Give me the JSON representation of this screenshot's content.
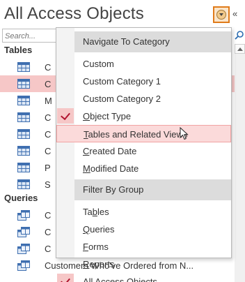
{
  "pane": {
    "title": "All Access Objects",
    "collapse_glyph": "«",
    "search_placeholder": "Search...",
    "groups": [
      {
        "name": "Tables",
        "icon": "table-icon",
        "items": [
          {
            "label": "C"
          },
          {
            "label": "C",
            "selected": true
          },
          {
            "label": "M"
          },
          {
            "label": "C"
          },
          {
            "label": "C"
          },
          {
            "label": "C"
          },
          {
            "label": "P"
          },
          {
            "label": "S"
          }
        ]
      },
      {
        "name": "Queries",
        "icon": "query-icon",
        "items": [
          {
            "label": "C"
          },
          {
            "label": "C"
          },
          {
            "label": "C"
          },
          {
            "label": "Customers Who've Ordered from N..."
          }
        ]
      }
    ]
  },
  "menu": {
    "navigate_header": "Navigate To Category",
    "navigate_items": [
      {
        "label": "Custom",
        "checked": false
      },
      {
        "label": "Custom Category 1",
        "checked": false
      },
      {
        "label": "Custom Category 2",
        "checked": false
      },
      {
        "label": "Object Type",
        "checked": true,
        "underline_char": "O",
        "rest": "bject Type"
      },
      {
        "label": "Tables and Related Views",
        "checked": false,
        "hover": true,
        "underline_char": "T",
        "rest": "ables and Related Views"
      },
      {
        "label": "Created Date",
        "checked": false,
        "underline_char": "C",
        "rest": "reated Date"
      },
      {
        "label": "Modified Date",
        "checked": false,
        "underline_char": "M",
        "rest": "odified Date"
      }
    ],
    "filter_header": "Filter By Group",
    "filter_items": [
      {
        "label": "Tables",
        "checked": false,
        "pre": "Ta",
        "underline_char": "b",
        "rest": "les"
      },
      {
        "label": "Queries",
        "checked": false,
        "underline_char": "Q",
        "rest": "ueries"
      },
      {
        "label": "Forms",
        "checked": false,
        "underline_char": "F",
        "rest": "orms"
      },
      {
        "label": "Reports",
        "checked": false,
        "underline_char": "R",
        "rest": "eports"
      },
      {
        "label": "All Access Objects",
        "checked": true,
        "underline_char": "A",
        "rest": "ll Access Objects"
      }
    ]
  },
  "colors": {
    "accent_orange": "#e07b1a",
    "selection_pink": "#f6c7c7",
    "check_red": "#b1132f",
    "menu_header_gray": "#dcdcdc"
  }
}
